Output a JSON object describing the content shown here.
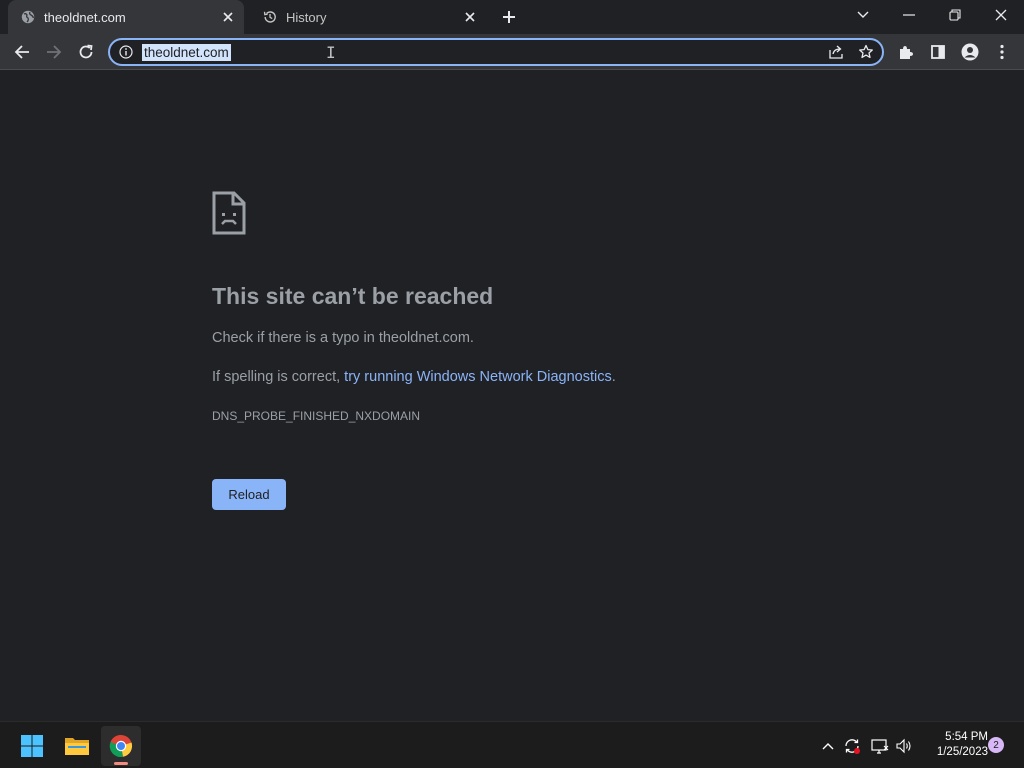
{
  "tabs": [
    {
      "title": "theoldnet.com",
      "icon": "globe-icon",
      "active": true
    },
    {
      "title": "History",
      "icon": "history-icon",
      "active": false
    }
  ],
  "omnibox": {
    "url": "theoldnet.com"
  },
  "error": {
    "title": "This site can’t be reached",
    "line1": "Check if there is a typo in theoldnet.com.",
    "line2_prefix": "If spelling is correct, ",
    "line2_link": "try running Windows Network Diagnostics",
    "line2_suffix": ".",
    "code": "DNS_PROBE_FINISHED_NXDOMAIN",
    "reload_label": "Reload"
  },
  "taskbar": {
    "time": "5:54 PM",
    "date": "1/25/2023",
    "notification_count": "2"
  },
  "colors": {
    "accent": "#8ab4f8",
    "page_bg": "#202124",
    "toolbar_bg": "#35363a"
  }
}
